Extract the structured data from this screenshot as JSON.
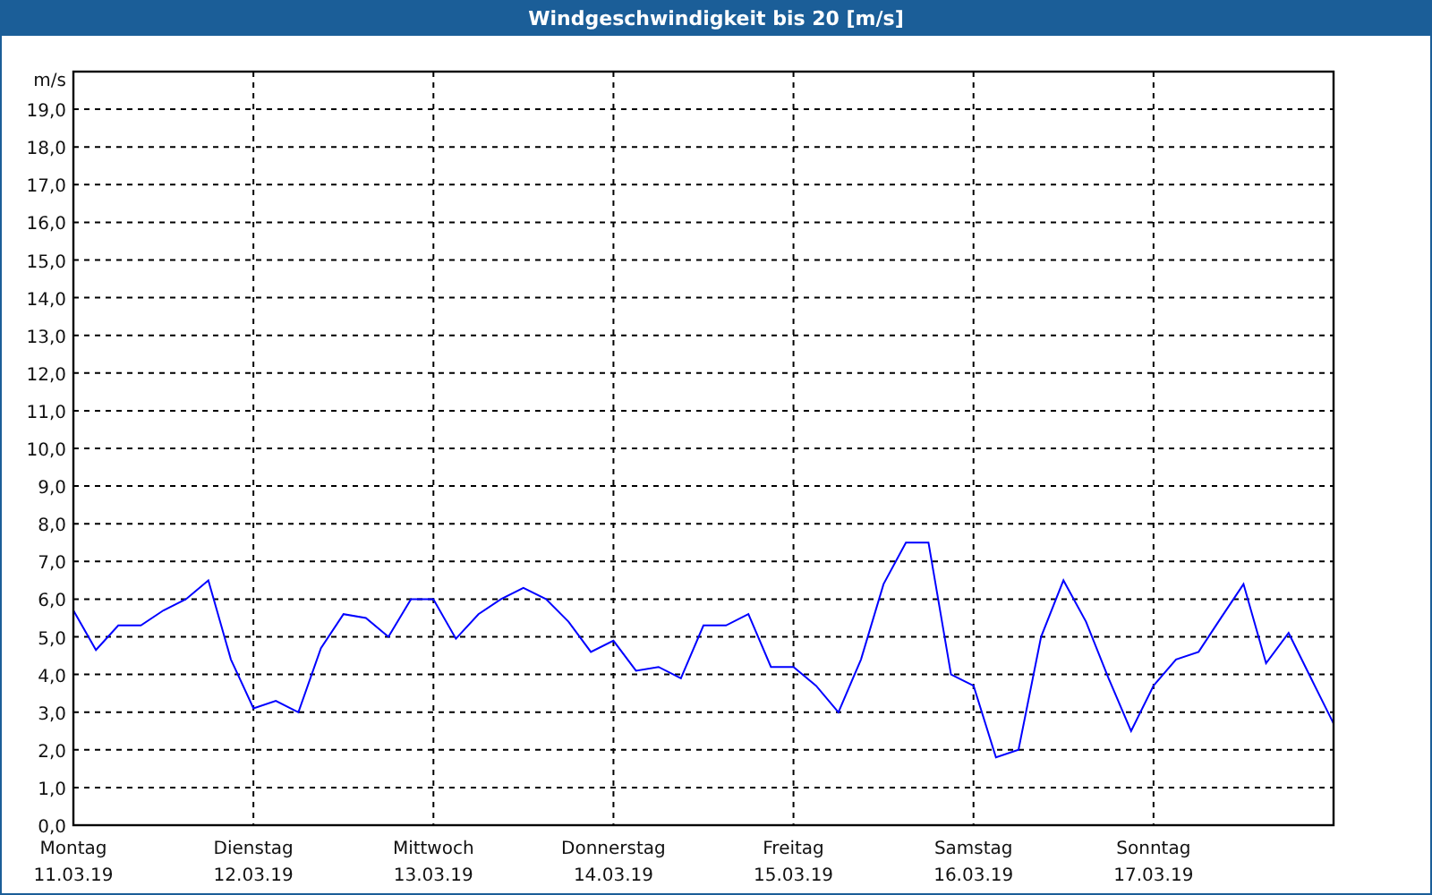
{
  "window": {
    "title": "Windgeschwindigkeit bis 20 [m/s]"
  },
  "chart": {
    "chart_data": {
      "type": "line",
      "grid": true,
      "ylabel": "m/s",
      "ylim": [
        0,
        20
      ],
      "yticks": [
        {
          "value": 0,
          "label": "0,0"
        },
        {
          "value": 1,
          "label": "1,0"
        },
        {
          "value": 2,
          "label": "2,0"
        },
        {
          "value": 3,
          "label": "3,0"
        },
        {
          "value": 4,
          "label": "4,0"
        },
        {
          "value": 5,
          "label": "5,0"
        },
        {
          "value": 6,
          "label": "6,0"
        },
        {
          "value": 7,
          "label": "7,0"
        },
        {
          "value": 8,
          "label": "8,0"
        },
        {
          "value": 9,
          "label": "9,0"
        },
        {
          "value": 10,
          "label": "10,0"
        },
        {
          "value": 11,
          "label": "11,0"
        },
        {
          "value": 12,
          "label": "12,0"
        },
        {
          "value": 13,
          "label": "13,0"
        },
        {
          "value": 14,
          "label": "14,0"
        },
        {
          "value": 15,
          "label": "15,0"
        },
        {
          "value": 16,
          "label": "16,0"
        },
        {
          "value": 17,
          "label": "17,0"
        },
        {
          "value": 18,
          "label": "18,0"
        },
        {
          "value": 19,
          "label": "19,0"
        }
      ],
      "categories": [
        "Montag\n11.03.19",
        null,
        null,
        null,
        null,
        null,
        null,
        null,
        "Dienstag\n12.03.19",
        null,
        null,
        null,
        null,
        null,
        null,
        null,
        "Mittwoch\n13.03.19",
        null,
        null,
        null,
        null,
        null,
        null,
        null,
        "Donnerstag\n14.03.19",
        null,
        null,
        null,
        null,
        null,
        null,
        null,
        "Freitag\n15.03.19",
        null,
        null,
        null,
        null,
        null,
        null,
        null,
        "Samstag\n16.03.19",
        null,
        null,
        null,
        null,
        null,
        null,
        null,
        "Sonntag\n17.03.19",
        null,
        null,
        null,
        null,
        null,
        null,
        null,
        null
      ],
      "series": [
        {
          "color": "#0000ff",
          "values": [
            5.7,
            4.65,
            5.3,
            5.3,
            5.7,
            6.0,
            6.5,
            4.4,
            3.1,
            3.3,
            3.0,
            4.7,
            5.6,
            5.5,
            5.0,
            6.0,
            6.0,
            4.95,
            5.6,
            6.0,
            6.3,
            6.0,
            5.4,
            4.6,
            4.9,
            4.1,
            4.2,
            3.9,
            5.3,
            5.3,
            5.6,
            4.2,
            4.2,
            3.7,
            3.0,
            4.4,
            6.4,
            7.5,
            7.5,
            4.0,
            3.7,
            1.8,
            2.0,
            5.0,
            6.5,
            5.4,
            3.9,
            2.5,
            3.7,
            4.4,
            4.6,
            5.5,
            6.4,
            4.3,
            5.1,
            3.9,
            2.7
          ]
        }
      ]
    }
  }
}
